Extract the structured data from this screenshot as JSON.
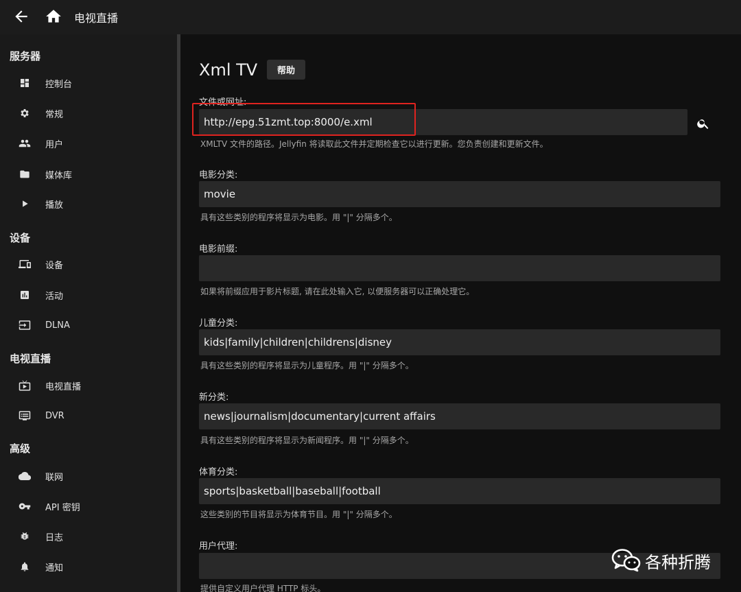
{
  "topbar": {
    "title": "电视直播",
    "back_icon": "arrow-left-icon",
    "home_icon": "home-icon"
  },
  "sidebar": {
    "sections": [
      {
        "title": "服务器",
        "items": [
          {
            "label": "控制台",
            "icon": "dashboard-icon"
          },
          {
            "label": "常规",
            "icon": "gear-icon"
          },
          {
            "label": "用户",
            "icon": "people-icon"
          },
          {
            "label": "媒体库",
            "icon": "folder-icon"
          },
          {
            "label": "播放",
            "icon": "play-icon"
          }
        ]
      },
      {
        "title": "设备",
        "items": [
          {
            "label": "设备",
            "icon": "devices-icon"
          },
          {
            "label": "活动",
            "icon": "activity-icon"
          },
          {
            "label": "DLNA",
            "icon": "input-icon"
          }
        ]
      },
      {
        "title": "电视直播",
        "items": [
          {
            "label": "电视直播",
            "icon": "tv-icon"
          },
          {
            "label": "DVR",
            "icon": "dvr-icon"
          }
        ]
      },
      {
        "title": "高级",
        "items": [
          {
            "label": "联网",
            "icon": "cloud-icon"
          },
          {
            "label": "API 密钥",
            "icon": "key-icon"
          },
          {
            "label": "日志",
            "icon": "bug-icon"
          },
          {
            "label": "通知",
            "icon": "bell-icon"
          }
        ]
      }
    ]
  },
  "main": {
    "title": "Xml TV",
    "help_label": "帮助",
    "fields": [
      {
        "label": "文件或网址:",
        "value": "http://epg.51zmt.top:8000/e.xml",
        "help": "XMLTV 文件的路径。Jellyfin 将读取此文件并定期检查它以进行更新。您负责创建和更新文件。"
      },
      {
        "label": "电影分类:",
        "value": "movie",
        "help": "具有这些类别的程序将显示为电影。用 \"|\" 分隔多个。"
      },
      {
        "label": "电影前缀:",
        "value": "",
        "help": "如果将前缀应用于影片标题, 请在此处输入它, 以便服务器可以正确处理它。"
      },
      {
        "label": "儿童分类:",
        "value": "kids|family|children|childrens|disney",
        "help": "具有这些类别的程序将显示为儿童程序。用 \"|\" 分隔多个。"
      },
      {
        "label": "新分类:",
        "value": "news|journalism|documentary|current affairs",
        "help": "具有这些类别的程序将显示为新闻程序。用 \"|\" 分隔多个。"
      },
      {
        "label": "体育分类:",
        "value": "sports|basketball|baseball|football",
        "help": "这些类别的节目将显示为体育节目。用 \"|\" 分隔多个。"
      },
      {
        "label": "用户代理:",
        "value": "",
        "help": "提供自定义用户代理 HTTP 标头。"
      }
    ],
    "search_icon": "search-icon"
  },
  "watermark": {
    "text": "各种折腾",
    "icon": "wechat-icon"
  }
}
